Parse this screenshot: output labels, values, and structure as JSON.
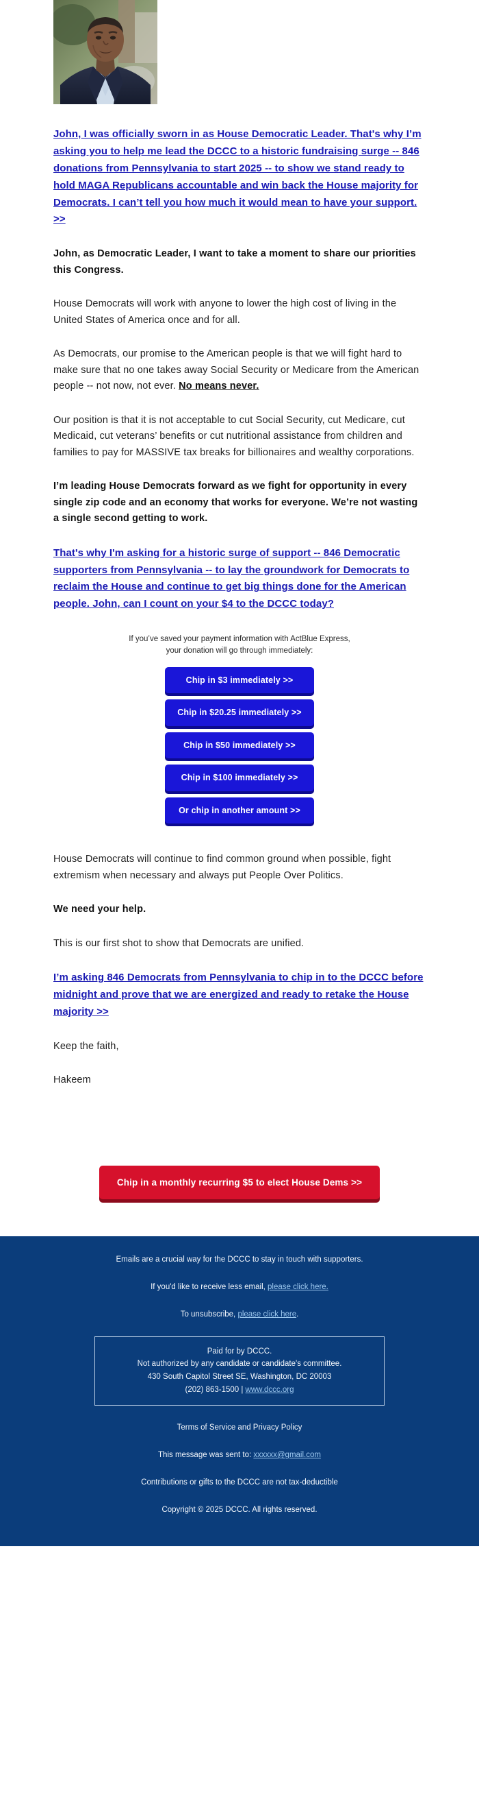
{
  "hero": {
    "photo_alt": "Hakeem Jeffries portrait"
  },
  "headline_link": "John, I was officially sworn in as House Democratic Leader. That's why I’m asking you to help me lead the DCCC to a historic fundraising surge -- 846 donations from Pennsylvania to start 2025 -- to show we stand ready to hold MAGA Republicans accountable and win back the House majority for Democrats. I can’t tell you how much it would mean to have your support. >>",
  "body": {
    "p1": "John, as Democratic Leader, I want to take a moment to share our priorities this Congress.",
    "p2": "House Democrats will work with anyone to lower the high cost of living in the United States of America once and for all.",
    "p3_part1": "As Democrats, our promise to the American people is that we will fight hard to make sure that no one takes away Social Security or Medicare from the American people -- not now, not ever. ",
    "p3_emphasis": "No means never.",
    "p4": "Our position is that it is not acceptable to cut Social Security, cut Medicare, cut Medicaid, cut veterans’ benefits or cut nutritional assistance from children and families to pay for MASSIVE tax breaks for billionaires and wealthy corporations.",
    "p5": "I’m leading House Democrats forward as we fight for opportunity in every single zip code and an economy that works for everyone. We’re not wasting a single second getting to work.",
    "p6": "House Democrats will continue to find common ground when possible, fight extremism when necessary and always put People Over Politics.",
    "p7": "We need your help.",
    "p8": "This is our first shot to show that Democrats are unified.",
    "signoff_1": "Keep the faith,",
    "signoff_2": "Hakeem"
  },
  "mid_link": "That's why I'm asking for a historic surge of support -- 846 Democratic supporters from Pennsylvania -- to lay the groundwork for Democrats to reclaim the House and continue to get big things done for the American people. John, can I count on your $4 to the DCCC today?",
  "final_link": "I’m asking 846 Democrats from Pennsylvania to chip in to the DCCC before midnight and prove that we are energized and ready to retake the House majority >>",
  "donate": {
    "note_line1": "If you’ve saved your payment information with ActBlue Express,",
    "note_line2": "your donation will go through immediately:",
    "buttons": [
      {
        "label": "Chip in $3 immediately >>",
        "amount": "$3"
      },
      {
        "label": "Chip in $20.25 immediately >>",
        "amount": "$20.25"
      },
      {
        "label": "Chip in $50 immediately >>",
        "amount": "$50"
      },
      {
        "label": "Chip in $100 immediately >>",
        "amount": "$100"
      },
      {
        "label": "Or chip in another amount >>",
        "amount": "other"
      }
    ],
    "button_color": "#1a16d8"
  },
  "recurring": {
    "label": "Chip in a monthly recurring $5 to elect House Dems >>",
    "color": "#d6112c"
  },
  "footer": {
    "bg_color": "#0b3d7b",
    "line1": "Emails are a crucial way for the DCCC to stay in touch with supporters.",
    "line2_prefix": "If you'd like to receive less email, ",
    "line2_link": "please click here.",
    "line3_prefix": "To unsubscribe, ",
    "line3_link": "please click here",
    "line3_suffix": ".",
    "disclaimer": {
      "l1": "Paid for by DCCC.",
      "l2": "Not authorized by any candidate or candidate's committee.",
      "l3": "430 South Capitol Street SE, Washington, DC 20003",
      "l4_prefix": "(202) 863-1500 | ",
      "l4_link": "www.dccc.org"
    },
    "terms": "Terms of Service and Privacy Policy",
    "sent_to_prefix": "This message was sent to: ",
    "sent_to_email": "xxxxxx@gmail.com",
    "tax": "Contributions or gifts to the DCCC are not tax-deductible",
    "copyright": "Copyright © 2025 DCCC. All rights reserved."
  }
}
